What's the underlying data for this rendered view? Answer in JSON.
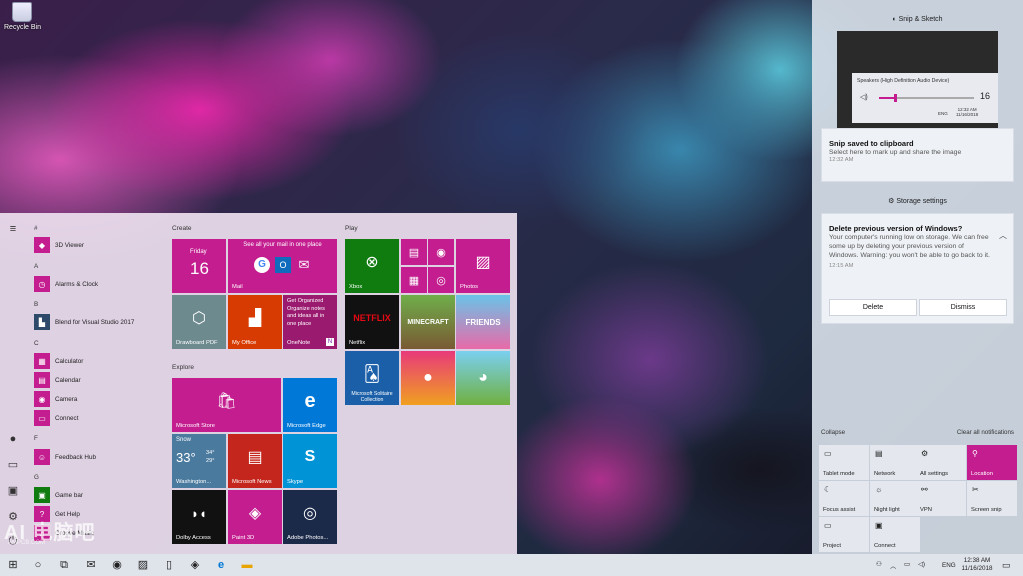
{
  "desktop": {
    "recycle_label": "Recycle Bin"
  },
  "start": {
    "apps": [
      {
        "letter": "#",
        "name": "3D Viewer"
      },
      {
        "letter": "A",
        "name": "Alarms & Clock"
      },
      {
        "letter": "B",
        "name": "Blend for Visual Studio 2017"
      },
      {
        "letter": "C",
        "name": "Calculator"
      },
      {
        "name": "Calendar"
      },
      {
        "name": "Camera"
      },
      {
        "name": "Connect"
      },
      {
        "letter": "F",
        "name": "Feedback Hub"
      },
      {
        "letter": "G",
        "name": "Game bar"
      },
      {
        "name": "Get Help"
      },
      {
        "name": "Groove Music"
      }
    ],
    "groups": {
      "create": "Create",
      "explore": "Explore",
      "play": "Play"
    },
    "tiles": {
      "calendar": {
        "day": "Friday",
        "date": "16"
      },
      "mail": {
        "text": "See all your mail in one place",
        "label": "Mail"
      },
      "drawboard": "Drawboard PDF",
      "myoffice": "My Office",
      "onenote": {
        "text": "Get Organized Organize notes and ideas all in one place",
        "label": "OneNote"
      },
      "store": "Microsoft Store",
      "edge": "Microsoft Edge",
      "weather": {
        "cond": "Snow",
        "temp": "33°",
        "hi": "34°",
        "lo": "29°",
        "city": "Washington..."
      },
      "news": "Microsoft News",
      "skype": "Skype",
      "dolby": "Dolby Access",
      "paint3d": "Paint 3D",
      "photoshop": "Adobe Photos...",
      "xbox": "Xbox",
      "photos": "Photos",
      "netflix": {
        "logo": "NETFLIX",
        "label": "Netflix"
      },
      "minecraft": "MINECRAFT",
      "friends": "FRIENDS",
      "solitaire": "Microsoft Solitaire Collection"
    }
  },
  "action_center": {
    "snip_header": "Snip & Sketch",
    "volume": {
      "device": "Speakers (High Definition Audio Device)",
      "level": "16",
      "time": "12:32 AM",
      "date": "11/16/2018",
      "lang": "ENG"
    },
    "snip_card": {
      "title": "Snip saved to clipboard",
      "body": "Select here to mark up and share the image",
      "time": "12:32 AM"
    },
    "storage_header": "Storage settings",
    "storage_card": {
      "title": "Delete previous version of Windows?",
      "body": "Your computer's running low on storage. We can free some up by deleting your previous version of Windows. Warning: you won't be able to go back to it.",
      "time": "12:15 AM",
      "delete": "Delete",
      "dismiss": "Dismiss"
    },
    "collapse": "Collapse",
    "clear_all": "Clear all notifications",
    "quick_actions": [
      "Tablet mode",
      "Network",
      "All settings",
      "Location",
      "Focus assist",
      "Night light",
      "VPN",
      "Screen snip",
      "Project",
      "Connect"
    ]
  },
  "taskbar": {
    "time": "12:38 AM",
    "date": "11/16/2018",
    "lang": "ENG"
  },
  "watermark": {
    "main": "AI 电脑吧",
    "sub": "AMPCB.COM"
  },
  "colors": {
    "accent": "#c31d8f"
  }
}
